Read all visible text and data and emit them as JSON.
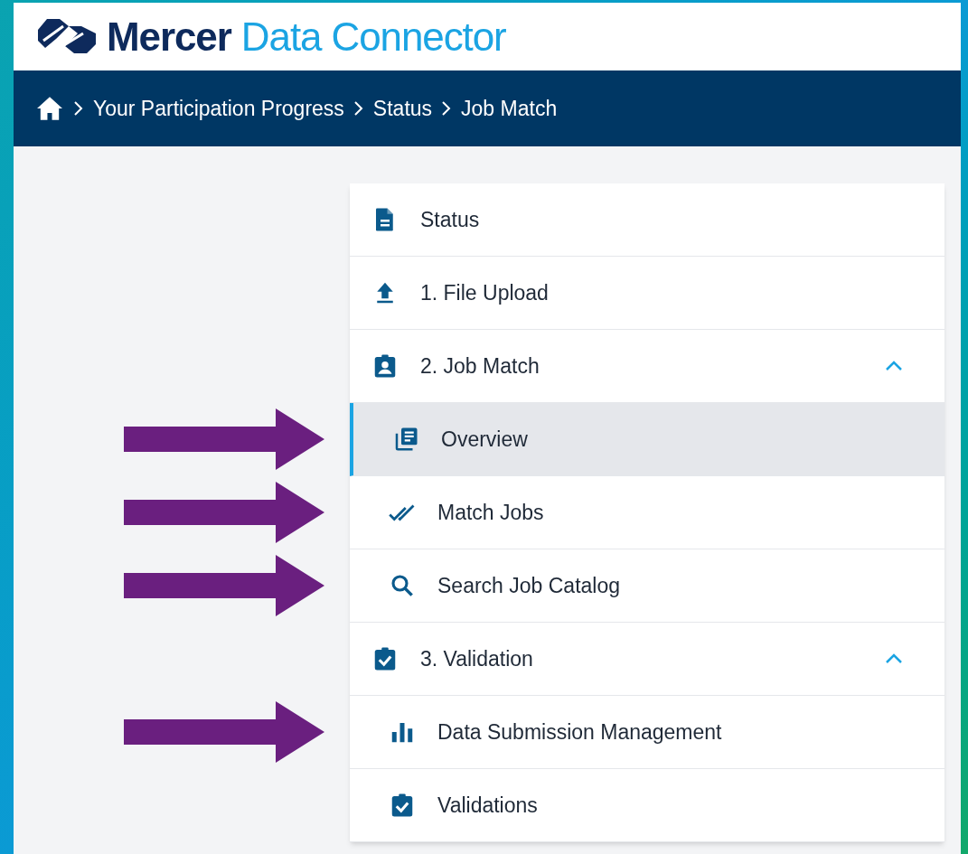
{
  "header": {
    "brand": "Mercer",
    "product": "Data Connector"
  },
  "breadcrumb": [
    "Your Participation Progress",
    "Status",
    "Job Match"
  ],
  "menu": [
    {
      "label": "Status"
    },
    {
      "label": "1. File Upload"
    },
    {
      "label": "2. Job Match",
      "expanded": true,
      "children": [
        {
          "label": "Overview",
          "selected": true,
          "annotated": true
        },
        {
          "label": "Match Jobs",
          "selected": false,
          "annotated": true
        },
        {
          "label": "Search Job Catalog",
          "selected": false,
          "annotated": true
        }
      ]
    },
    {
      "label": "3. Validation",
      "expanded": true,
      "children": [
        {
          "label": "Data Submission Management",
          "selected": false,
          "annotated": true
        },
        {
          "label": "Validations",
          "selected": false,
          "annotated": false
        }
      ]
    }
  ]
}
